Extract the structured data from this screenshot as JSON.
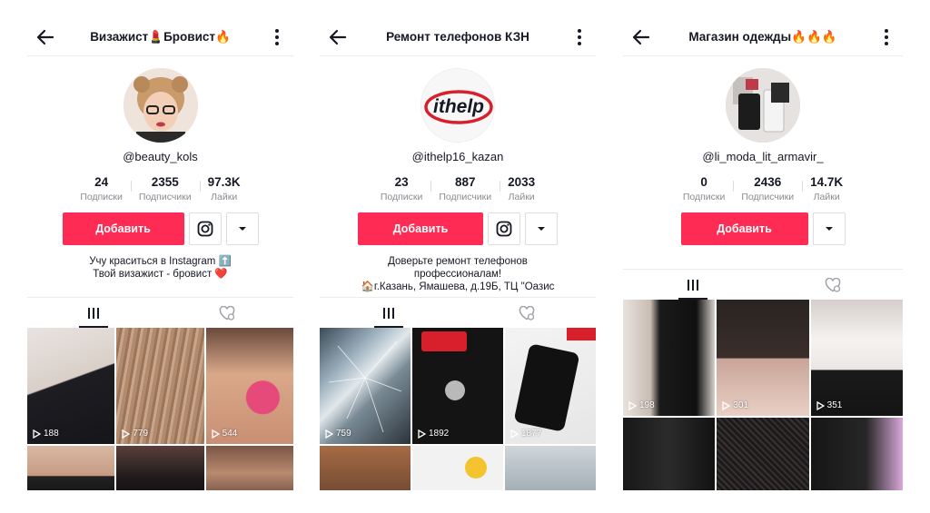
{
  "panels": [
    {
      "title": "Визажист💄Бровист🔥",
      "username": "@beauty_kols",
      "stats": [
        {
          "value": "24",
          "label": "Подписки"
        },
        {
          "value": "2355",
          "label": "Подписчики"
        },
        {
          "value": "97.3K",
          "label": "Лайки"
        }
      ],
      "follow_label": "Добавить",
      "bio": [
        "Учу краситься в Instagram ⬆️",
        "Твой визажист - бровист ❤️"
      ],
      "videos": [
        {
          "views": "188"
        },
        {
          "views": "779"
        },
        {
          "views": "544"
        },
        {
          "views": ""
        },
        {
          "views": ""
        },
        {
          "views": ""
        }
      ]
    },
    {
      "title": "Ремонт телефонов КЗН",
      "username": "@ithelp16_kazan",
      "logo_text": "ithelp",
      "stats": [
        {
          "value": "23",
          "label": "Подписки"
        },
        {
          "value": "887",
          "label": "Подписчики"
        },
        {
          "value": "2033",
          "label": "Лайки"
        }
      ],
      "follow_label": "Добавить",
      "bio": [
        "Доверьте ремонт телефонов",
        "профессионалам!",
        "🏠г.Казань, Ямашева, д.19Б, ТЦ \"Оазис"
      ],
      "videos": [
        {
          "views": "759"
        },
        {
          "views": "1892"
        },
        {
          "views": "1877"
        },
        {
          "views": ""
        },
        {
          "views": ""
        },
        {
          "views": ""
        }
      ]
    },
    {
      "title": "Магазин одежды🔥🔥🔥",
      "username": "@li_moda_lit_armavir_",
      "stats": [
        {
          "value": "0",
          "label": "Подписки"
        },
        {
          "value": "2436",
          "label": "Подписчики"
        },
        {
          "value": "14.7K",
          "label": "Лайки"
        }
      ],
      "follow_label": "Добавить",
      "bio": [],
      "videos": [
        {
          "views": "198"
        },
        {
          "views": "301"
        },
        {
          "views": "351"
        },
        {
          "views": ""
        },
        {
          "views": ""
        },
        {
          "views": ""
        }
      ]
    }
  ],
  "icons": {
    "back": "back-arrow-icon",
    "more": "more-vertical-icon",
    "instagram": "instagram-icon",
    "dropdown": "caret-down-icon",
    "videos_tab": "videos-grid-icon",
    "liked_tab": "liked-heart-icon",
    "play": "play-icon"
  },
  "colors": {
    "accent": "#fe2c55",
    "text": "#161823",
    "muted": "#8a8b91"
  }
}
